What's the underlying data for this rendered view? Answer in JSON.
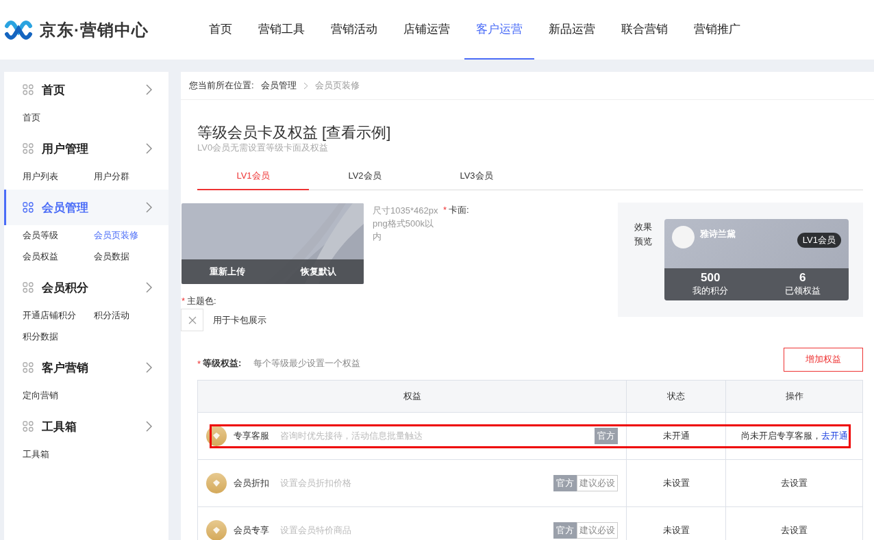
{
  "logo": {
    "text": "京东·营销中心"
  },
  "nav": [
    {
      "label": "首页",
      "selected": false
    },
    {
      "label": "营销工具",
      "selected": false
    },
    {
      "label": "营销活动",
      "selected": false
    },
    {
      "label": "店铺运营",
      "selected": false
    },
    {
      "label": "客户运营",
      "selected": true
    },
    {
      "label": "新品运营",
      "selected": false
    },
    {
      "label": "联合营销",
      "selected": false
    },
    {
      "label": "营销推广",
      "selected": false
    }
  ],
  "sidebar": [
    {
      "title": "首页",
      "selected": false,
      "items": [
        {
          "label": "首页",
          "selected": false
        }
      ]
    },
    {
      "title": "用户管理",
      "selected": false,
      "items": [
        {
          "label": "用户列表",
          "selected": false
        },
        {
          "label": "用户分群",
          "selected": false
        }
      ]
    },
    {
      "title": "会员管理",
      "selected": true,
      "items": [
        {
          "label": "会员等级",
          "selected": false
        },
        {
          "label": "会员页装修",
          "selected": true
        },
        {
          "label": "会员权益",
          "selected": false
        },
        {
          "label": "会员数据",
          "selected": false
        }
      ]
    },
    {
      "title": "会员积分",
      "selected": false,
      "items": [
        {
          "label": "开通店铺积分",
          "selected": false
        },
        {
          "label": "积分活动",
          "selected": false
        },
        {
          "label": "积分数据",
          "selected": false
        }
      ]
    },
    {
      "title": "客户营销",
      "selected": false,
      "items": [
        {
          "label": "定向营销",
          "selected": false
        }
      ]
    },
    {
      "title": "工具箱",
      "selected": false,
      "items": [
        {
          "label": "工具箱",
          "selected": false
        }
      ]
    }
  ],
  "breadcrumb": {
    "label": "您当前所在位置:",
    "items": [
      "会员管理",
      "会员页装修"
    ]
  },
  "heading": {
    "title": "等级会员卡及权益 [查看示例]",
    "subtitle": "LV0会员无需设置等级卡面及权益"
  },
  "level_tabs": [
    {
      "label": "LV1会员",
      "selected": true
    },
    {
      "label": "LV2会员",
      "selected": false
    },
    {
      "label": "LV3会员",
      "selected": false
    }
  ],
  "card_upload": {
    "buttons": [
      "重新上传",
      "恢复默认"
    ],
    "hint": "尺寸1035*462px png格式500k以内",
    "label": "卡面:",
    "required_mark": "*"
  },
  "theme_color": {
    "label": "主题色:",
    "hint": "用于卡包展示",
    "required_mark": "*"
  },
  "preview": {
    "label": "效果预览",
    "shop_name": "雅诗兰黛",
    "badge": "LV1会员",
    "stats": [
      {
        "value": "500",
        "label": "我的积分"
      },
      {
        "value": "6",
        "label": "已领权益"
      }
    ]
  },
  "rights": {
    "label": "等级权益:",
    "required_mark": "*",
    "hint": "每个等级最少设置一个权益",
    "add_button": "增加权益",
    "columns": [
      "权益",
      "状态",
      "操作"
    ],
    "rows": [
      {
        "name": "专享客服",
        "desc": "咨询时优先接待，活动信息批量触达",
        "tags": [
          {
            "label": "官方",
            "kind": "official"
          }
        ],
        "status": "未开通",
        "action": "尚未开启专享客服，",
        "link": "去开通",
        "highlighted": true
      },
      {
        "name": "会员折扣",
        "desc": "设置会员折扣价格",
        "tags": [
          {
            "label": "官方",
            "kind": "official"
          },
          {
            "label": "建议必设",
            "kind": "suggest"
          }
        ],
        "status": "未设置",
        "link": "去设置",
        "highlighted": false
      },
      {
        "name": "会员专享",
        "desc": "设置会员特价商品",
        "tags": [
          {
            "label": "官方",
            "kind": "official"
          },
          {
            "label": "建议必设",
            "kind": "suggest"
          }
        ],
        "status": "未设置",
        "link": "去设置",
        "highlighted": false
      }
    ]
  }
}
